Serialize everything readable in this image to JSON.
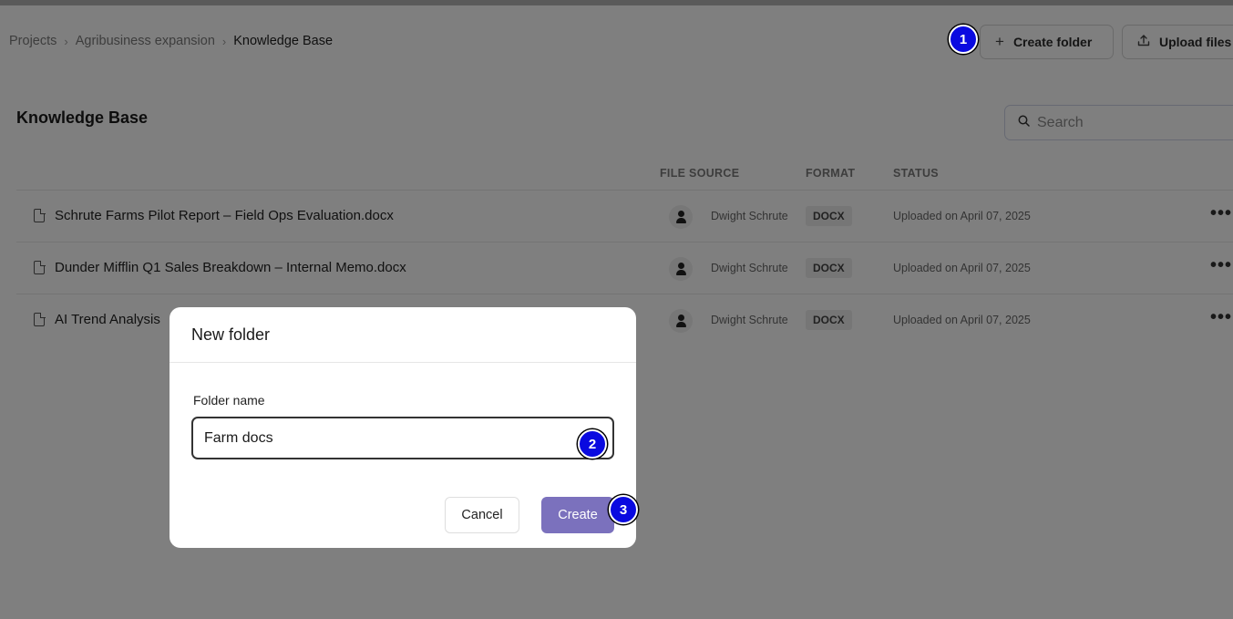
{
  "breadcrumb": {
    "items": [
      "Projects",
      "Agribusiness expansion",
      "Knowledge Base"
    ]
  },
  "header": {
    "create_folder_label": "Create folder",
    "upload_files_label": "Upload files"
  },
  "page": {
    "title": "Knowledge Base"
  },
  "search": {
    "placeholder": "Search"
  },
  "table": {
    "columns": [
      "FILE SOURCE",
      "FORMAT",
      "STATUS"
    ],
    "rows": [
      {
        "name": "Schrute Farms Pilot Report – Field Ops Evaluation.docx",
        "owner": "Dwight Schrute",
        "format": "DOCX",
        "status": "Uploaded on April 07, 2025"
      },
      {
        "name": "Dunder Mifflin Q1 Sales Breakdown – Internal Memo.docx",
        "owner": "Dwight Schrute",
        "format": "DOCX",
        "status": "Uploaded on April 07, 2025"
      },
      {
        "name": "AI Trend Analysis",
        "owner": "Dwight Schrute",
        "format": "DOCX",
        "status": "Uploaded on April 07, 2025"
      }
    ]
  },
  "modal": {
    "title": "New folder",
    "field_label": "Folder name",
    "field_value": "Farm docs",
    "cancel_label": "Cancel",
    "create_label": "Create"
  },
  "markers": [
    "1",
    "2",
    "3"
  ],
  "colors": {
    "primary": "#7b71bd",
    "marker": "#0a0ae0"
  },
  "icons": {
    "create_folder": "plus-icon",
    "upload": "upload-icon",
    "search": "search-icon",
    "file": "document-icon",
    "avatar": "user-icon",
    "more": "more-horizontal-icon"
  }
}
